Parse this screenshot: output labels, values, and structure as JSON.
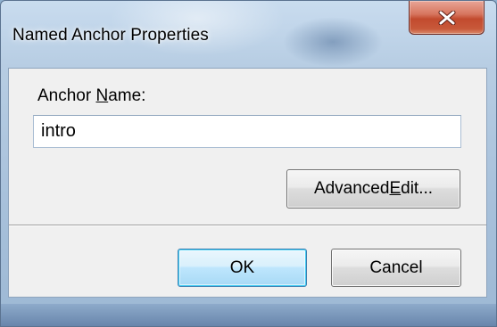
{
  "window": {
    "title": "Named Anchor Properties",
    "close_icon": "close-icon"
  },
  "form": {
    "anchor_label_prefix": "Anchor ",
    "anchor_label_accel": "N",
    "anchor_label_suffix": "ame:",
    "anchor_name_value": "intro"
  },
  "buttons": {
    "advanced_prefix": "Advanced ",
    "advanced_accel": "E",
    "advanced_suffix": "dit...",
    "ok": "OK",
    "cancel": "Cancel"
  },
  "colors": {
    "close_button": "#c24a2e",
    "default_button_border": "#3c7fb1",
    "dialog_background": "#f0f0f0"
  }
}
